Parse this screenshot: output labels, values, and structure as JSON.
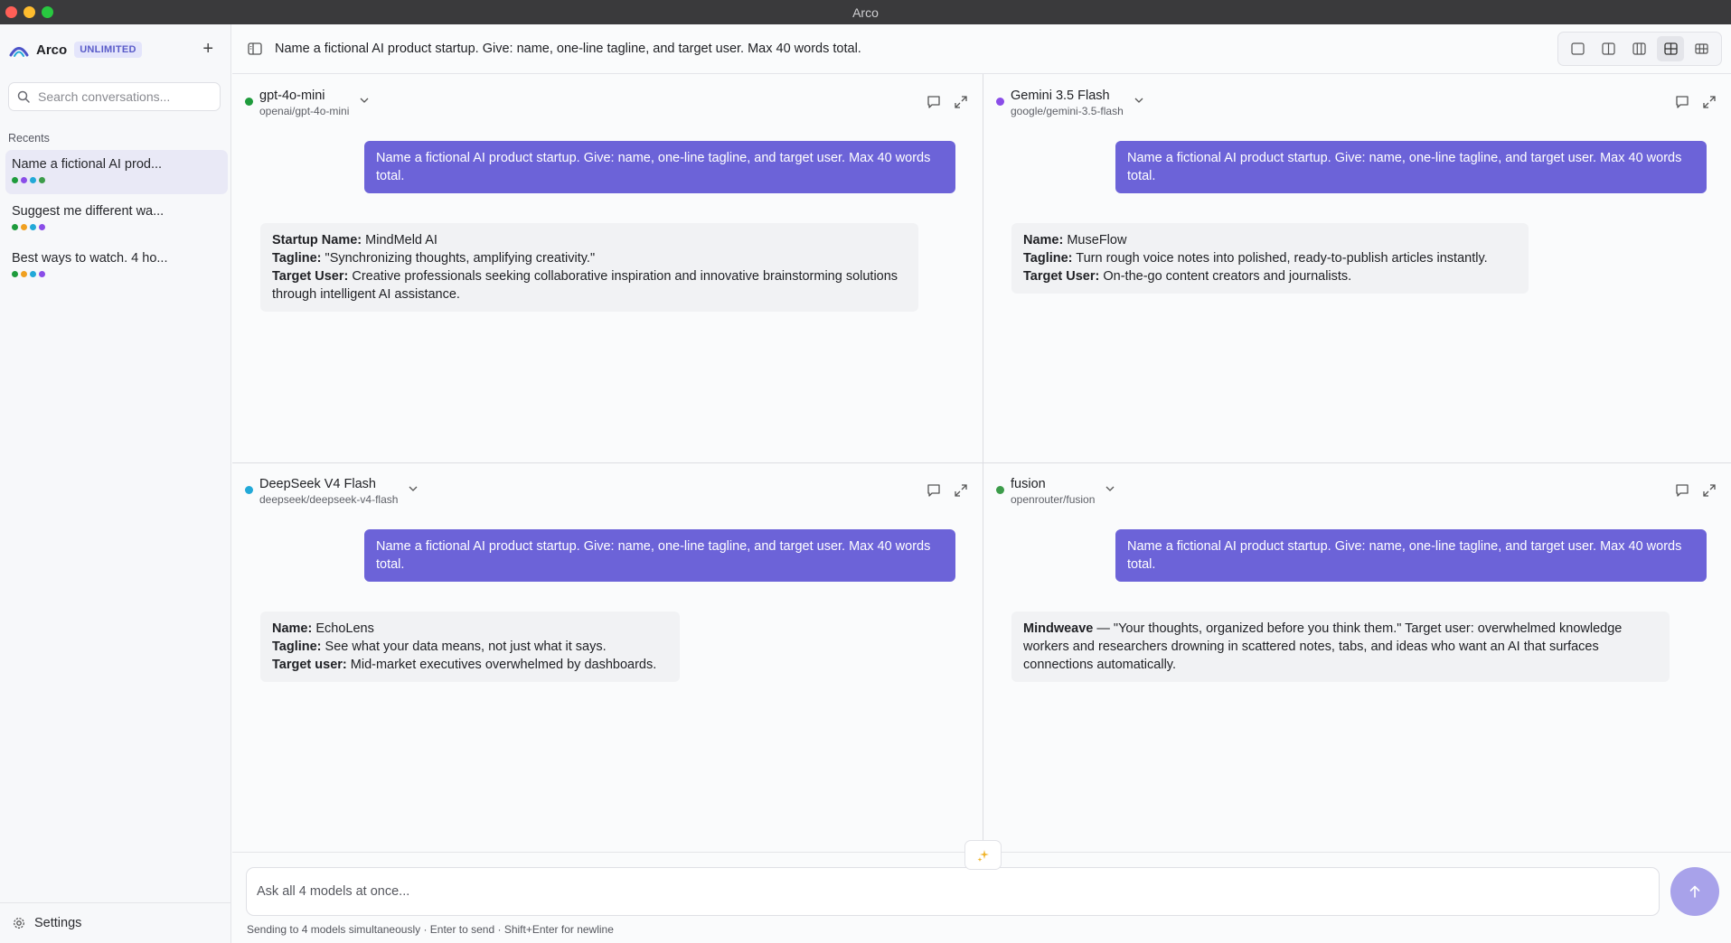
{
  "window": {
    "title": "Arco"
  },
  "sidebar": {
    "brand": "Arco",
    "badge": "UNLIMITED",
    "new_chat_label": "+",
    "search_placeholder": "Search conversations...",
    "recents_label": "Recents",
    "conversations": [
      {
        "title": "Name a fictional AI prod...",
        "active": true,
        "dots": [
          "#1e9b3c",
          "#8a4de8",
          "#22a9d8",
          "#3c9c4a"
        ]
      },
      {
        "title": "Suggest me different wa...",
        "active": false,
        "dots": [
          "#1e9b3c",
          "#f0a020",
          "#22a9d8",
          "#8a4de8"
        ]
      },
      {
        "title": "Best ways to watch. 4 ho...",
        "active": false,
        "dots": [
          "#1e9b3c",
          "#f0a020",
          "#22a9d8",
          "#8a4de8"
        ]
      }
    ],
    "settings_label": "Settings"
  },
  "topbar": {
    "title": "Name a fictional AI product startup. Give: name, one-line tagline, and target user. Max 40 words total.",
    "layouts": [
      "single",
      "two-column",
      "three-column",
      "grid-2x2",
      "grid-3x2"
    ],
    "selected_layout": "grid-2x2"
  },
  "panes": [
    {
      "model_name": "gpt-4o-mini",
      "model_id": "openai/gpt-4o-mini",
      "status_color": "#1e9b3c",
      "user_message": "Name a fictional AI product startup. Give: name, one-line tagline, and target user. Max 40 words total.",
      "reply": [
        {
          "label": "Startup Name:",
          "text": " MindMeld AI"
        },
        {
          "label": "Tagline:",
          "text": " \"Synchronizing thoughts, amplifying creativity.\""
        },
        {
          "label": "Target User:",
          "text": " Creative professionals seeking collaborative inspiration and innovative brainstorming solutions through intelligent AI assistance."
        }
      ]
    },
    {
      "model_name": "Gemini 3.5 Flash",
      "model_id": "google/gemini-3.5-flash",
      "status_color": "#8a4de8",
      "user_message": "Name a fictional AI product startup. Give: name, one-line tagline, and target user. Max 40 words total.",
      "reply": [
        {
          "label": "Name:",
          "text": " MuseFlow"
        },
        {
          "label": "Tagline:",
          "text": " Turn rough voice notes into polished, ready-to-publish articles instantly."
        },
        {
          "label": "Target User:",
          "text": " On-the-go content creators and journalists."
        }
      ]
    },
    {
      "model_name": "DeepSeek V4 Flash",
      "model_id": "deepseek/deepseek-v4-flash",
      "status_color": "#22a9d8",
      "user_message": "Name a fictional AI product startup. Give: name, one-line tagline, and target user. Max 40 words total.",
      "reply": [
        {
          "label": "Name:",
          "text": " EchoLens"
        },
        {
          "label": "Tagline:",
          "text": " See what your data means, not just what it says."
        },
        {
          "label": "Target user:",
          "text": " Mid-market executives overwhelmed by dashboards."
        }
      ]
    },
    {
      "model_name": "fusion",
      "model_id": "openrouter/fusion",
      "status_color": "#3c9c4a",
      "user_message": "Name a fictional AI product startup. Give: name, one-line tagline, and target user. Max 40 words total.",
      "reply": [
        {
          "label": "Mindweave",
          "text": " — \"Your thoughts, organized before you think them.\" Target user: overwhelmed knowledge workers and researchers drowning in scattered notes, tabs, and ideas who want an AI that surfaces connections automatically."
        }
      ]
    }
  ],
  "composer": {
    "placeholder": "Ask all 4 models at once...",
    "hint": "Sending to 4 models simultaneously · Enter to send · Shift+Enter for newline"
  },
  "colors": {
    "accent": "#6c63d8",
    "send_button": "#a8a2ea"
  }
}
